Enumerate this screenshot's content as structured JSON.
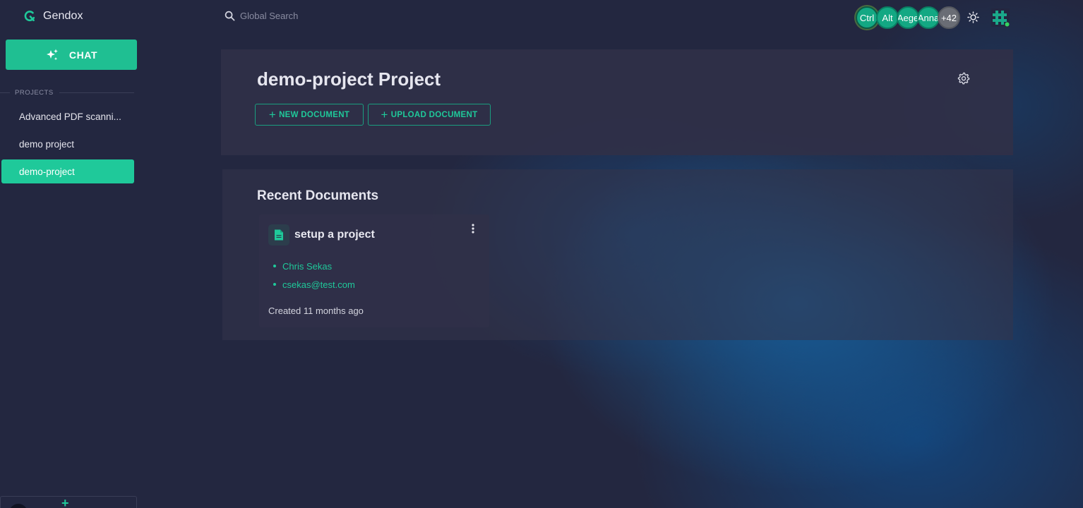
{
  "app": {
    "name": "Gendox"
  },
  "sidebar": {
    "chat_label": "CHAT",
    "projects_heading": "PROJECTS",
    "projects": [
      {
        "label": "Advanced PDF scanni...",
        "active": false
      },
      {
        "label": "demo project",
        "active": false
      },
      {
        "label": "demo-project",
        "active": true
      }
    ],
    "bottom_add_icon": "plus-icon"
  },
  "topbar": {
    "search_placeholder": "Global Search",
    "avatars": [
      "Ctrl",
      "Alt",
      "Aege",
      "Anna",
      "+42"
    ],
    "theme_icon": "sun-icon",
    "user_icon": "pixel-avatar-icon"
  },
  "project": {
    "title": "demo-project Project",
    "new_document_label": "NEW DOCUMENT",
    "upload_document_label": "UPLOAD DOCUMENT"
  },
  "recent": {
    "heading": "Recent Documents",
    "documents": [
      {
        "title": "setup a project",
        "author": "Chris Sekas",
        "email": "csekas@test.com",
        "created": "Created 11 months ago"
      }
    ]
  },
  "colors": {
    "accent": "#1fc99a",
    "background": "#232740",
    "panel": "#303048"
  }
}
